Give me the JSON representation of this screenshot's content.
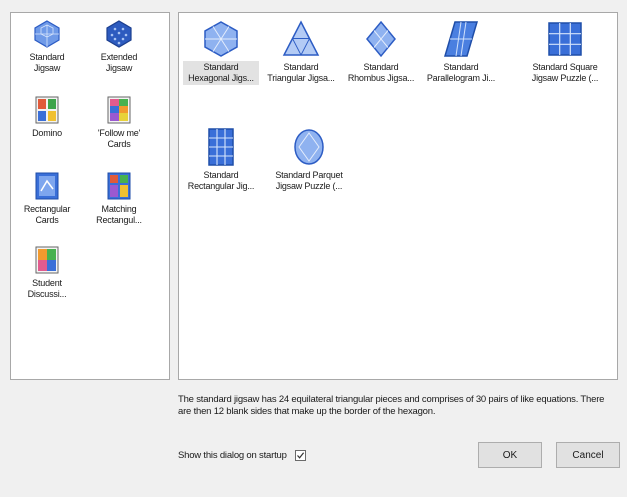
{
  "categories": [
    {
      "label": "Standard\nJigsaw",
      "icon": "hexagon-grid-icon"
    },
    {
      "label": "Extended\nJigsaw",
      "icon": "hexagon-dots-icon"
    },
    {
      "label": "Domino",
      "icon": "domino-icon"
    },
    {
      "label": "'Follow me'\nCards",
      "icon": "follow-me-cards-icon"
    },
    {
      "label": "Rectangular\nCards",
      "icon": "rectangular-cards-icon"
    },
    {
      "label": "Matching\nRectangul...",
      "icon": "matching-rectangles-icon"
    },
    {
      "label": "Student\nDiscussi...",
      "icon": "student-discussion-icon"
    }
  ],
  "templates": [
    {
      "label": "Standard\nHexagonal Jigs...",
      "icon": "hexagon-jigsaw-icon",
      "selected": true
    },
    {
      "label": "Standard\nTriangular Jigsa...",
      "icon": "triangle-jigsaw-icon",
      "selected": false
    },
    {
      "label": "Standard\nRhombus Jigsa...",
      "icon": "rhombus-jigsaw-icon",
      "selected": false
    },
    {
      "label": "Standard\nParallelogram Ji...",
      "icon": "parallelogram-jigsaw-icon",
      "selected": false
    },
    {
      "label": "Standard Square\nJigsaw Puzzle (...",
      "icon": "square-jigsaw-icon",
      "selected": false
    },
    {
      "label": "Standard\nRectangular Jig...",
      "icon": "rectangle-jigsaw-icon",
      "selected": false
    },
    {
      "label": "Standard Parquet\nJigsaw Puzzle (...",
      "icon": "parquet-jigsaw-icon",
      "selected": false
    }
  ],
  "description": "The standard jigsaw has 24 equilateral triangular pieces and comprises of 30 pairs of like equations. There are then 12 blank sides that make up the border of the hexagon.",
  "startup": {
    "label": "Show this dialog on startup",
    "checked": true
  },
  "buttons": {
    "ok": "OK",
    "cancel": "Cancel"
  },
  "colors": {
    "icon_blue": "#3a6fd8",
    "icon_light": "#bcd2f6",
    "selection": "#e2e2e2"
  }
}
